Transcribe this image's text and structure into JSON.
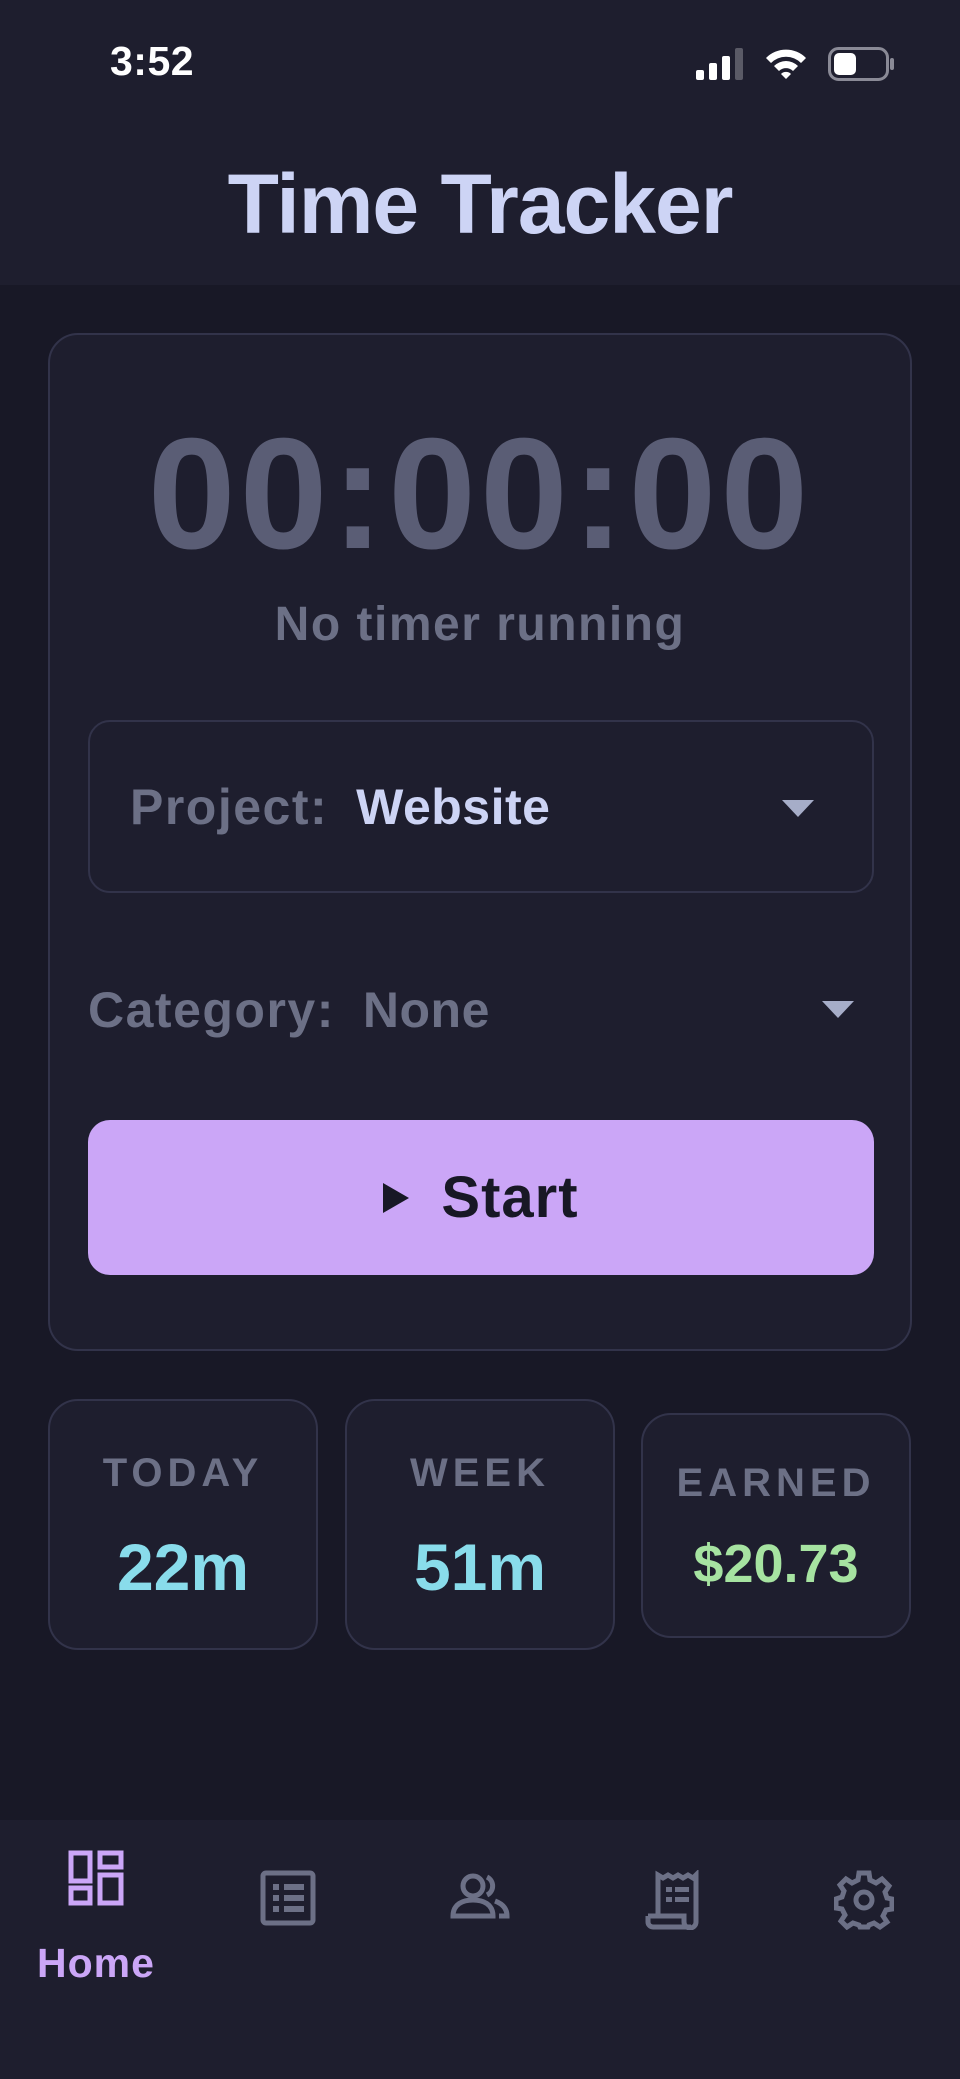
{
  "status_bar": {
    "time": "3:52",
    "icons": [
      "cellular-signal-icon",
      "wifi-icon",
      "battery-icon"
    ]
  },
  "header": {
    "title": "Time Tracker"
  },
  "timer": {
    "display": "00:00:00",
    "status": "No timer running"
  },
  "project": {
    "label": "Project:",
    "value": "Website"
  },
  "category": {
    "label": "Category:",
    "value": "None"
  },
  "start_button": {
    "label": "Start",
    "icon": "play-icon"
  },
  "stats": {
    "today": {
      "label": "TODAY",
      "value": "22m"
    },
    "week": {
      "label": "WEEK",
      "value": "51m"
    },
    "earned": {
      "label": "EARNED",
      "value": "$20.73"
    }
  },
  "nav": {
    "items": [
      {
        "label": "Home",
        "icon": "dashboard-icon",
        "active": true
      },
      {
        "icon": "list-icon"
      },
      {
        "icon": "people-icon"
      },
      {
        "icon": "receipt-icon"
      },
      {
        "icon": "gear-icon"
      }
    ]
  },
  "colors": {
    "background": "#181826",
    "surface": "#1e1e2e",
    "border": "#32334a",
    "accent": "#cba6f7",
    "title": "#cdd4f5",
    "muted": "#6c7086",
    "timer": "#5a5d75",
    "time_value": "#89dceb",
    "money_value": "#a6e3a1"
  }
}
